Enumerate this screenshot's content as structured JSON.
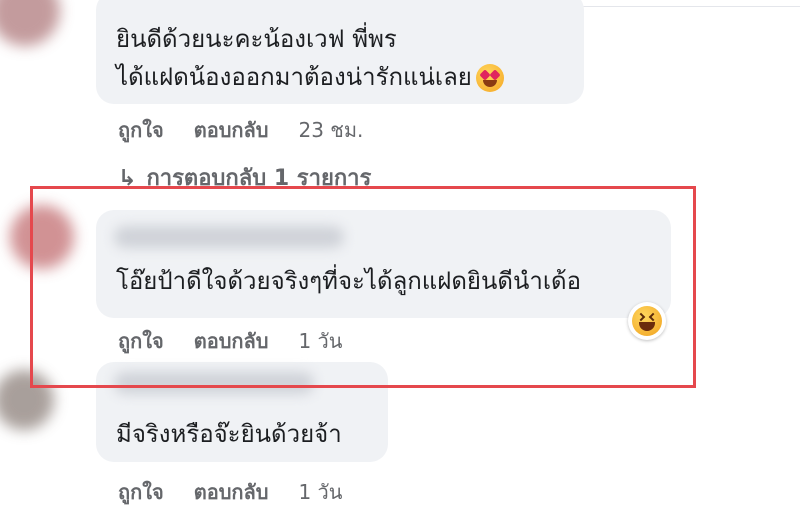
{
  "comments": [
    {
      "text_line1": "ยินดีด้วยนะคะน้องเวฟ พี่พร",
      "text_line2": "ได้แฝดน้องออกมาต้องน่ารักแน่เลย",
      "emoji": "heart-eyes",
      "like": "ถูกใจ",
      "reply": "ตอบกลับ",
      "time": "23 ชม.",
      "replies_link": "การตอบกลับ 1 รายการ"
    },
    {
      "text": "โอ๊ยป้าดีใจด้วยจริงๆที่จะได้ลูกแฝดยินดีนำเด้อ",
      "reaction": "laughing",
      "like": "ถูกใจ",
      "reply": "ตอบกลับ",
      "time": "1 วัน"
    },
    {
      "text": "มีจริงหรือจ๊ะยินด้วยจ้า",
      "like": "ถูกใจ",
      "reply": "ตอบกลับ",
      "time": "1 วัน"
    }
  ],
  "colors": {
    "bubble": "#f0f2f5",
    "text": "#1c1e21",
    "meta": "#65676b",
    "highlight": "#e5484d"
  }
}
